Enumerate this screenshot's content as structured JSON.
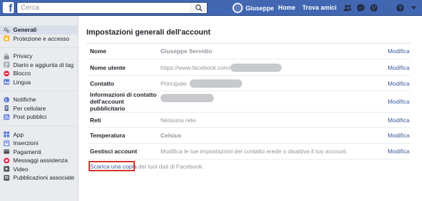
{
  "topbar": {
    "search_placeholder": "Cerca",
    "user_name": "Giuseppe",
    "home": "Home",
    "find_friends": "Trova amici"
  },
  "sidebar": {
    "groups": [
      [
        {
          "label": "Generali",
          "icon": "gear-icon",
          "active": true
        },
        {
          "label": "Protezione e accesso",
          "icon": "shield-icon"
        }
      ],
      [
        {
          "label": "Privacy",
          "icon": "lock-icon"
        },
        {
          "label": "Diario e aggiunta di tag",
          "icon": "timeline-icon"
        },
        {
          "label": "Blocco",
          "icon": "block-icon"
        },
        {
          "label": "Lingua",
          "icon": "language-icon"
        }
      ],
      [
        {
          "label": "Notifiche",
          "icon": "globe-icon"
        },
        {
          "label": "Per cellulare",
          "icon": "phone-icon"
        },
        {
          "label": "Post pubblici",
          "icon": "rss-icon"
        }
      ],
      [
        {
          "label": "App",
          "icon": "apps-icon"
        },
        {
          "label": "Inserzioni",
          "icon": "ads-icon"
        },
        {
          "label": "Pagamenti",
          "icon": "payments-icon"
        },
        {
          "label": "Messaggi assistenza",
          "icon": "support-icon"
        },
        {
          "label": "Video",
          "icon": "video-icon"
        },
        {
          "label": "Pubblicazioni associate",
          "icon": "publications-icon"
        }
      ]
    ]
  },
  "main": {
    "title": "Impostazioni generali dell'account",
    "edit_label": "Modifica",
    "rows": {
      "name": {
        "label": "Nome",
        "value": "Giuseppe Servidio"
      },
      "username": {
        "label": "Nome utente",
        "value": "https://www.facebook.com/"
      },
      "contact": {
        "label": "Contatto",
        "value": "Principale:"
      },
      "ad_contact": {
        "label": "Informazioni di contatto dell'account pubblicitario"
      },
      "networks": {
        "label": "Reti",
        "value": "Nessuna rete."
      },
      "temperature": {
        "label": "Temperatura",
        "value": "Celsius"
      },
      "manage": {
        "label": "Gestisci account",
        "value": "Modifica le tue impostazioni del contatto erede o disattiva il tuo account."
      }
    },
    "download_link": "Scarica una copia",
    "download_rest": " dei tuoi dati di Facebook."
  },
  "colors": {
    "brand": "#4267b2",
    "link": "#365899",
    "highlight": "#d93025"
  }
}
